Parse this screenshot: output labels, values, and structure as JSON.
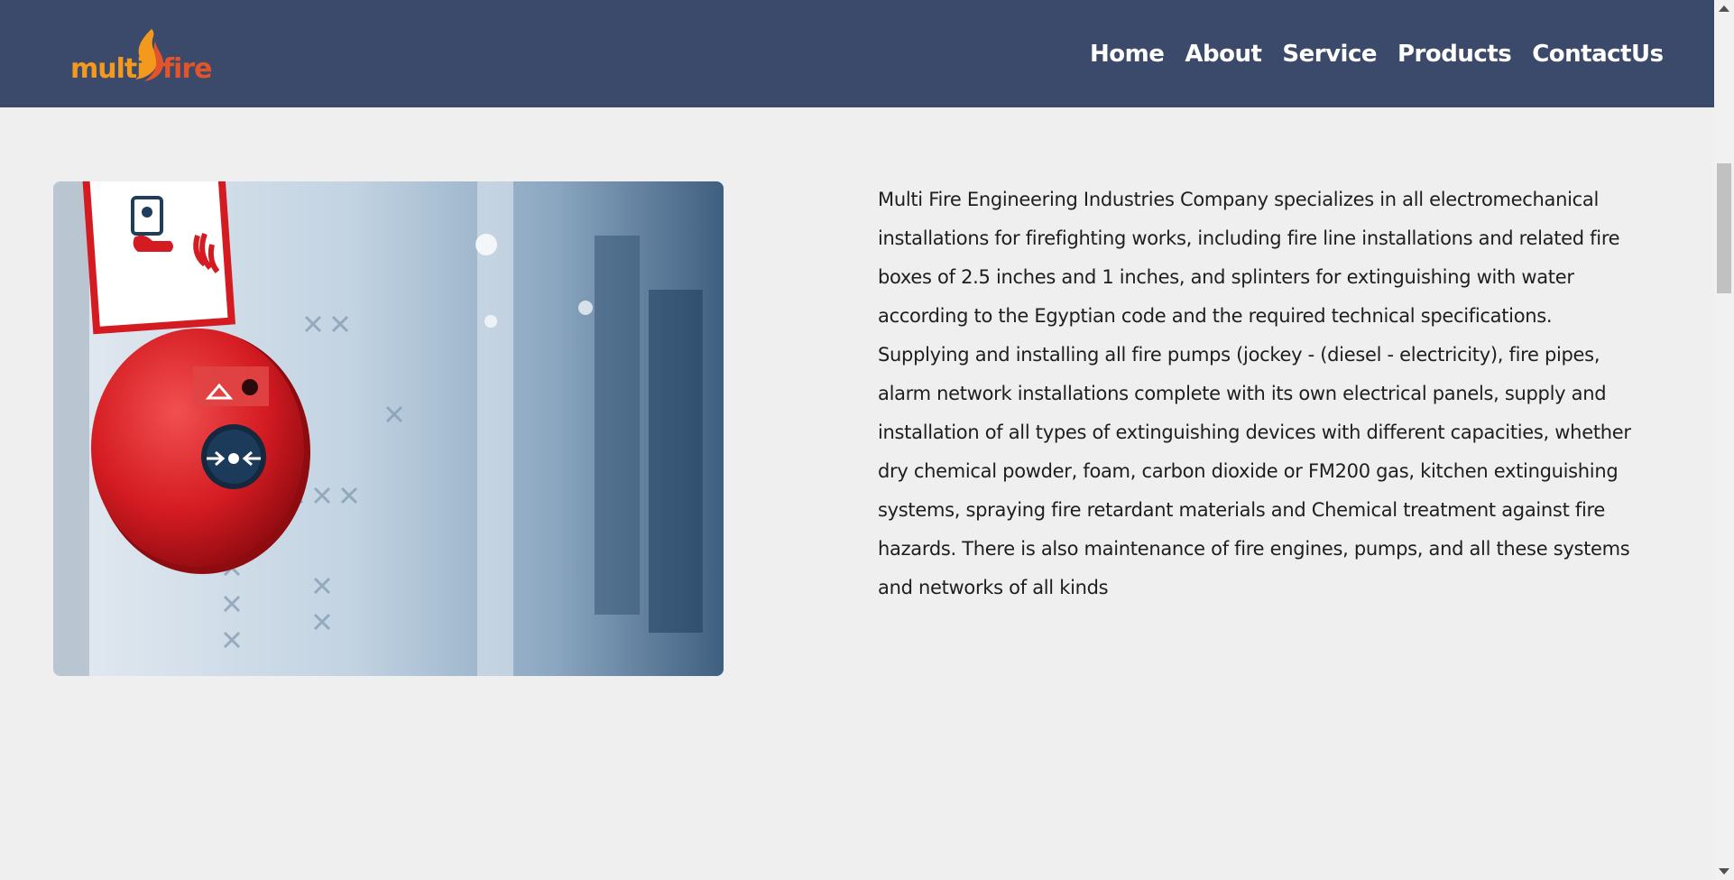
{
  "brand": {
    "logo_text_multi": "multi",
    "logo_text_fire": "fire",
    "logo_color_primary": "#f39a1e",
    "logo_color_secondary": "#e4542b"
  },
  "nav": {
    "items": [
      {
        "label": "Home"
      },
      {
        "label": "About"
      },
      {
        "label": "Service"
      },
      {
        "label": "Products"
      },
      {
        "label": "ContactUs"
      }
    ]
  },
  "hero": {
    "image_icon": "fire-alarm-call-point-photo"
  },
  "about": {
    "text": "Multi Fire Engineering Industries Company specializes in all electromechanical installations for firefighting works, including fire line installations and related fire boxes of 2.5 inches and 1 inches, and splinters for extinguishing with water according to the Egyptian code and the required technical specifications. Supplying and installing all fire pumps (jockey - (diesel - electricity), fire pipes, alarm network installations complete with its own electrical panels, supply and installation of all types of extinguishing devices with different capacities, whether dry chemical powder, foam, carbon dioxide or FM200 gas, kitchen extinguishing systems, spraying fire retardant materials and Chemical treatment against fire hazards. There is also maintenance of fire engines, pumps, and all these systems and networks of all kinds"
  },
  "colors": {
    "header_bg": "#3b4a6b",
    "page_bg": "#efefef",
    "nav_text": "#ffffff",
    "body_text": "#1e1e1e"
  }
}
